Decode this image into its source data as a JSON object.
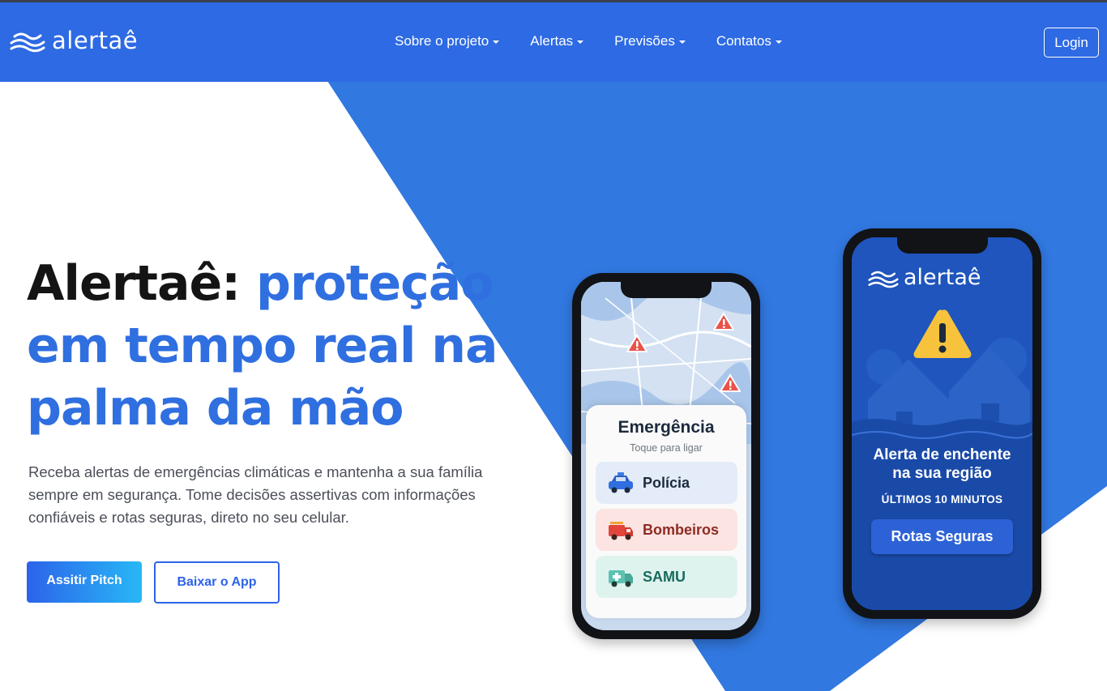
{
  "header": {
    "brand": "alertaê",
    "menu": [
      {
        "label": "Sobre o projeto"
      },
      {
        "label": "Alertas"
      },
      {
        "label": "Previsões"
      },
      {
        "label": "Contatos"
      }
    ],
    "login_label": "Login"
  },
  "hero": {
    "title_prefix": "Alertaê: ",
    "title_highlight": "proteção em tempo real na palma da mão",
    "description": "Receba alertas de emergências climáticas e mantenha a sua família sempre em segurança. Tome decisões assertivas com informações confiáveis e rotas seguras, direto no seu celular.",
    "primary_button": "Assitir Pitch",
    "secondary_button": "Baixar o App"
  },
  "phone_emergency": {
    "title": "Emergência",
    "subtitle": "Toque para ligar",
    "buttons": [
      {
        "label": "Polícia"
      },
      {
        "label": "Bombeiros"
      },
      {
        "label": "SAMU"
      }
    ]
  },
  "phone_alert": {
    "brand": "alertaê",
    "title_line1": "Alerta de enchente",
    "title_line2": "na sua região",
    "subtitle": "ÚLTIMOS 10 MINUTOS",
    "button": "Rotas Seguras"
  },
  "colors": {
    "header_blue": "#2d6ae3",
    "accent_blue": "#2f6fe0",
    "title_dark": "#141414",
    "polygon_blue": "#3178e0"
  }
}
